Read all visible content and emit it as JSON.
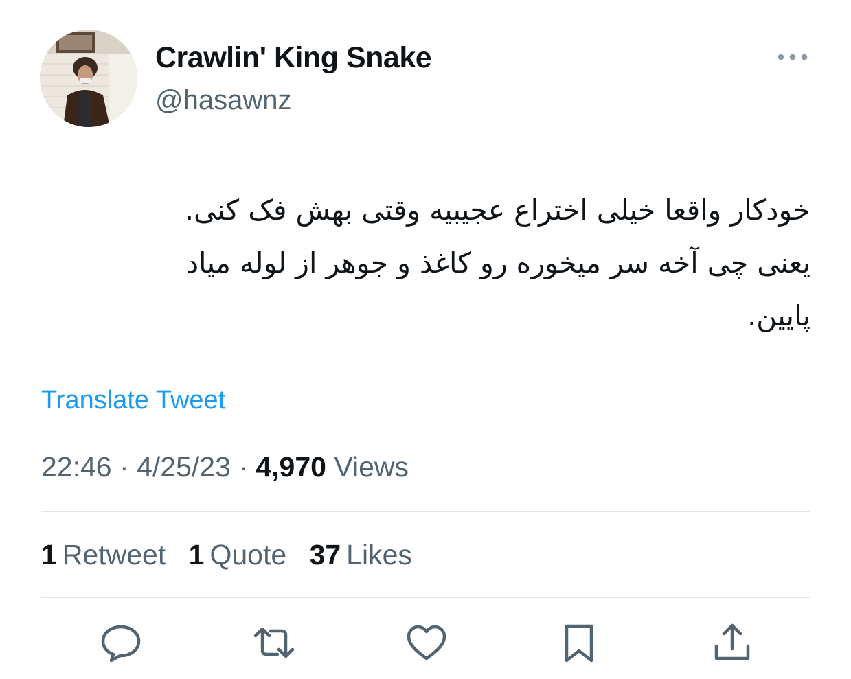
{
  "author": {
    "display_name": "Crawlin' King Snake",
    "handle": "@hasawnz",
    "avatar_icon": "user-avatar-photo"
  },
  "tweet": {
    "text_lines": [
      "خودکار واقعا خیلی اختراع عجیبیه وقتی بهش فک کنی.",
      "یعنی چی آخه سر میخوره رو کاغذ و جوهر از لوله میاد",
      "پایین."
    ],
    "translate_label": "Translate Tweet",
    "time": "22:46",
    "date": "4/25/23",
    "separator": "·",
    "views_count": "4,970",
    "views_label": "Views"
  },
  "stats": {
    "retweets_count": "1",
    "retweets_label": "Retweet",
    "quotes_count": "1",
    "quotes_label": "Quote",
    "likes_count": "37",
    "likes_label": "Likes"
  },
  "actions": [
    "reply-icon",
    "retweet-icon",
    "like-icon",
    "bookmark-icon",
    "share-icon"
  ],
  "colors": {
    "accent": "#1d9bf0",
    "secondary_text": "#536471",
    "primary_text": "#0f1419",
    "divider": "#e1e5e8"
  }
}
